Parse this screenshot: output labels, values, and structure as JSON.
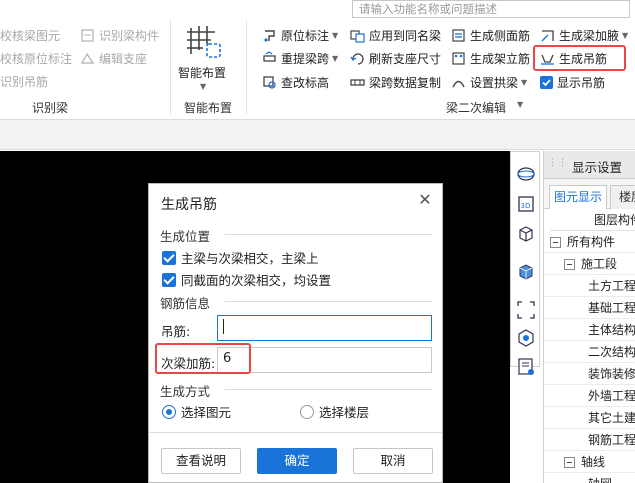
{
  "search": {
    "placeholder": "请输入功能名称或问题描述"
  },
  "ribbon": {
    "identify_beam": {
      "items": [
        "校核梁图元",
        "校核原位标注",
        "识别吊筋",
        "识别梁构件",
        "编辑支座"
      ],
      "label": "识别梁"
    },
    "smart_layout": {
      "button_label": "智能布置",
      "label": "智能布置"
    },
    "secondary_edit": {
      "items": [
        "原位标注",
        "应用到同名梁",
        "生成侧面筋",
        "生成梁加腋",
        "重提梁跨",
        "刷新支座尺寸",
        "生成架立筋",
        "生成吊筋",
        "查改标高",
        "梁跨数据复制",
        "设置拱梁",
        "显示吊筋"
      ],
      "label": "梁二次编辑"
    }
  },
  "vtools": [
    "sphere-view-icon",
    "3d-view-icon",
    "cube-outline-icon",
    "cube-solid-icon",
    "select-frame-icon",
    "component-icon",
    "list-view-icon"
  ],
  "panel": {
    "title": "显示设置",
    "tabs": [
      "图元显示",
      "楼层"
    ],
    "column_header": "图层构件",
    "tree": [
      {
        "label": "所有构件",
        "level": 0,
        "toggle": true
      },
      {
        "label": "施工段",
        "level": 1,
        "toggle": true
      },
      {
        "label": "土方工程",
        "level": 2
      },
      {
        "label": "基础工程",
        "level": 2
      },
      {
        "label": "主体结构",
        "level": 2
      },
      {
        "label": "二次结构",
        "level": 2
      },
      {
        "label": "装饰装修",
        "level": 2
      },
      {
        "label": "外墙工程",
        "level": 2
      },
      {
        "label": "其它土建",
        "level": 2
      },
      {
        "label": "钢筋工程",
        "level": 2
      },
      {
        "label": "轴线",
        "level": 1,
        "toggle": true
      },
      {
        "label": "轴网",
        "level": 2
      }
    ]
  },
  "dialog": {
    "title": "生成吊筋",
    "position_section": "生成位置",
    "options": [
      "主梁与次梁相交，主梁上",
      "同截面的次梁相交，均设置"
    ],
    "rebar_section": "钢筋信息",
    "hanger_label": "吊筋:",
    "hanger_value": "",
    "secondary_label": "次梁加筋:",
    "secondary_value": "6",
    "method_section": "生成方式",
    "methods": [
      "选择图元",
      "选择楼层"
    ],
    "buttons": {
      "help": "查看说明",
      "ok": "确定",
      "cancel": "取消"
    }
  },
  "colors": {
    "accent": "#1a73d9",
    "highlight": "#ec4646"
  }
}
